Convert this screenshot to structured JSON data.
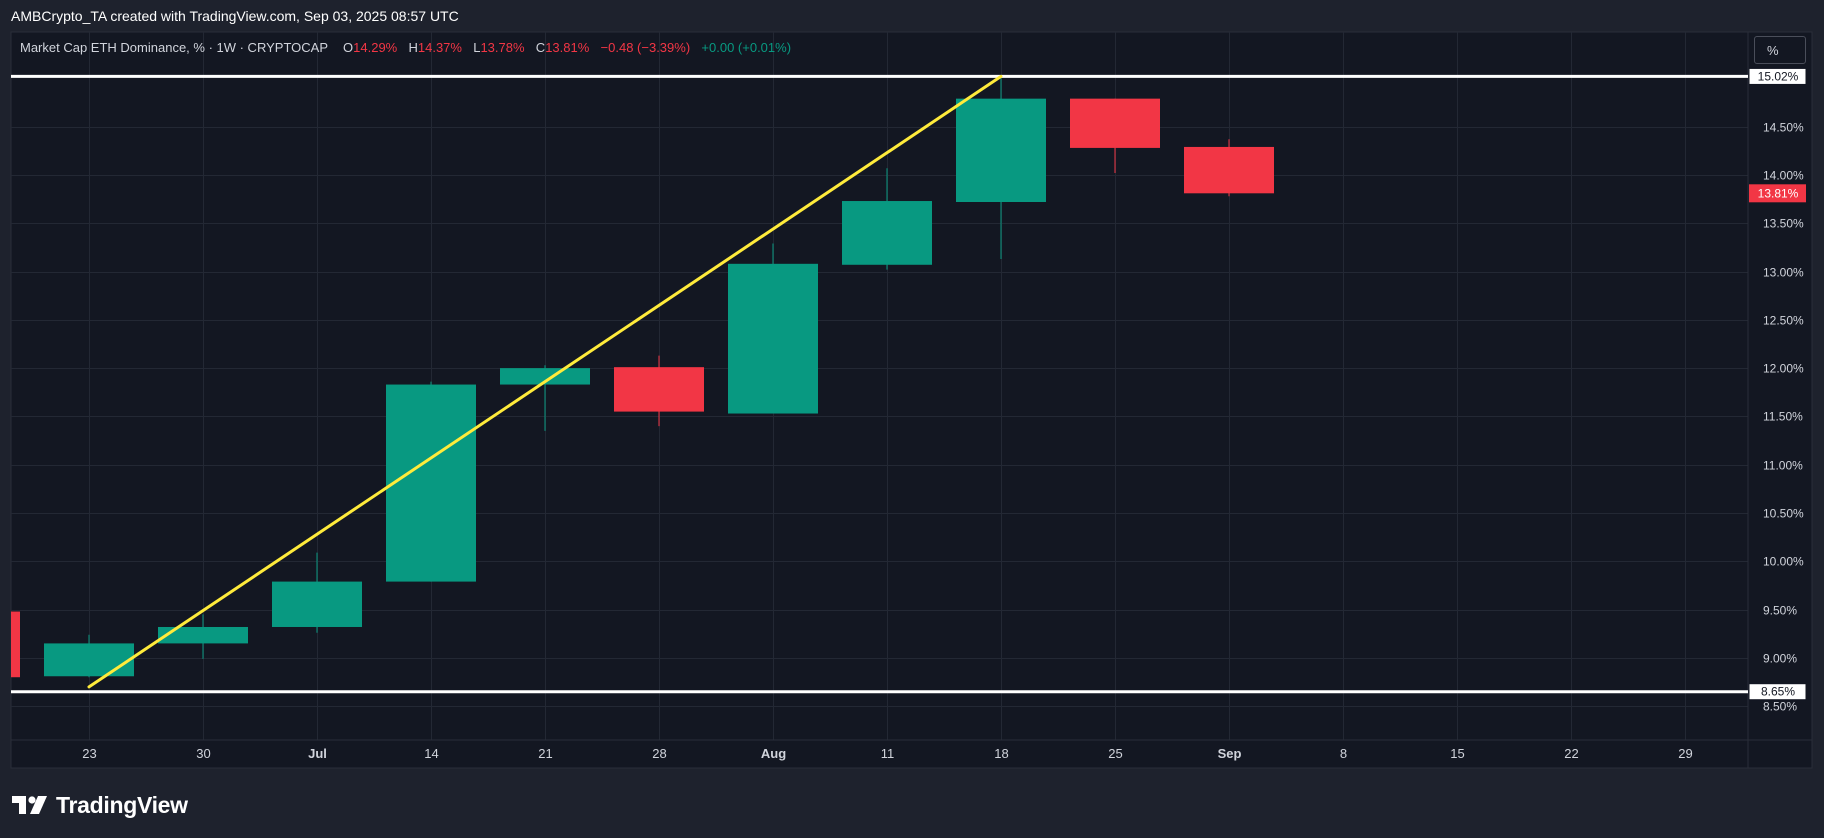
{
  "header": {
    "credit": "AMBCrypto_TA created with TradingView.com, Sep 03, 2025 08:57 UTC"
  },
  "legend": {
    "symbol": "Market Cap ETH Dominance, % · 1W · CRYPTOCAP",
    "open_label": "O",
    "open_value": "14.29%",
    "high_label": "H",
    "high_value": "14.37%",
    "low_label": "L",
    "low_value": "13.78%",
    "close_label": "C",
    "close_value": "13.81%",
    "change": "−0.48 (−3.39%)",
    "extra": "+0.00 (+0.01%)"
  },
  "scale_button": {
    "label": "%"
  },
  "brand": {
    "name": "TradingView",
    "logo_icon": "tradingview-logo-icon"
  },
  "colors": {
    "background": "#131722",
    "frame": "#1e222d",
    "grid": "#232834",
    "up": "#089981",
    "down": "#f23645",
    "trendline": "#ffeb3b",
    "level_line": "#ffffff"
  },
  "chart_data": {
    "type": "candlestick",
    "timeframe": "1W",
    "ylim": [
      8.15,
      15.48
    ],
    "y_ticks": [
      {
        "value": 8.5,
        "label": "8.50%"
      },
      {
        "value": 9.0,
        "label": "9.00%"
      },
      {
        "value": 9.5,
        "label": "9.50%"
      },
      {
        "value": 10.0,
        "label": "10.00%"
      },
      {
        "value": 10.5,
        "label": "10.50%"
      },
      {
        "value": 11.0,
        "label": "11.00%"
      },
      {
        "value": 11.5,
        "label": "11.50%"
      },
      {
        "value": 12.0,
        "label": "12.00%"
      },
      {
        "value": 12.5,
        "label": "12.50%"
      },
      {
        "value": 13.0,
        "label": "13.00%"
      },
      {
        "value": 13.5,
        "label": "13.50%"
      },
      {
        "value": 14.0,
        "label": "14.00%"
      },
      {
        "value": 14.5,
        "label": "14.50%"
      }
    ],
    "x_ticks": [
      {
        "label": "23",
        "date": "2025-06-23",
        "bold": false
      },
      {
        "label": "30",
        "date": "2025-06-30",
        "bold": false
      },
      {
        "label": "Jul",
        "date": "2025-07-07",
        "bold": true
      },
      {
        "label": "14",
        "date": "2025-07-14",
        "bold": false
      },
      {
        "label": "21",
        "date": "2025-07-21",
        "bold": false
      },
      {
        "label": "28",
        "date": "2025-07-28",
        "bold": false
      },
      {
        "label": "Aug",
        "date": "2025-08-04",
        "bold": true
      },
      {
        "label": "11",
        "date": "2025-08-11",
        "bold": false
      },
      {
        "label": "18",
        "date": "2025-08-18",
        "bold": false
      },
      {
        "label": "25",
        "date": "2025-08-25",
        "bold": false
      },
      {
        "label": "Sep",
        "date": "2025-09-01",
        "bold": true
      },
      {
        "label": "8",
        "date": "2025-09-08",
        "bold": false
      },
      {
        "label": "15",
        "date": "2025-09-15",
        "bold": false
      },
      {
        "label": "22",
        "date": "2025-09-22",
        "bold": false
      },
      {
        "label": "29",
        "date": "2025-09-29",
        "bold": false
      }
    ],
    "candles": [
      {
        "date": "2025-06-16",
        "open": 9.48,
        "high": 9.48,
        "low": 8.8,
        "close": 8.8
      },
      {
        "date": "2025-06-23",
        "open": 8.81,
        "high": 9.24,
        "low": 8.8,
        "close": 9.15
      },
      {
        "date": "2025-06-30",
        "open": 9.15,
        "high": 9.45,
        "low": 8.99,
        "close": 9.32
      },
      {
        "date": "2025-07-07",
        "open": 9.32,
        "high": 10.09,
        "low": 9.26,
        "close": 9.79
      },
      {
        "date": "2025-07-14",
        "open": 9.79,
        "high": 11.86,
        "low": 9.79,
        "close": 11.83
      },
      {
        "date": "2025-07-21",
        "open": 11.83,
        "high": 12.03,
        "low": 11.35,
        "close": 12.0
      },
      {
        "date": "2025-07-28",
        "open": 12.01,
        "high": 12.13,
        "low": 11.4,
        "close": 11.55
      },
      {
        "date": "2025-08-04",
        "open": 11.53,
        "high": 13.29,
        "low": 11.53,
        "close": 13.08
      },
      {
        "date": "2025-08-11",
        "open": 13.07,
        "high": 14.07,
        "low": 13.02,
        "close": 13.73
      },
      {
        "date": "2025-08-18",
        "open": 13.72,
        "high": 15.02,
        "low": 13.13,
        "close": 14.79
      },
      {
        "date": "2025-08-25",
        "open": 14.79,
        "high": 14.79,
        "low": 14.02,
        "close": 14.28
      },
      {
        "date": "2025-09-01",
        "open": 14.29,
        "high": 14.37,
        "low": 13.78,
        "close": 13.81
      }
    ],
    "horizontal_levels": [
      {
        "value": 15.02,
        "label": "15.02%"
      },
      {
        "value": 8.65,
        "label": "8.65%"
      }
    ],
    "trendline": {
      "start_date": "2025-06-23",
      "start_value": 8.7,
      "end_date": "2025-08-18",
      "end_value": 15.02
    },
    "last_price": {
      "value": 13.81,
      "label": "13.81%"
    },
    "grid": true
  }
}
